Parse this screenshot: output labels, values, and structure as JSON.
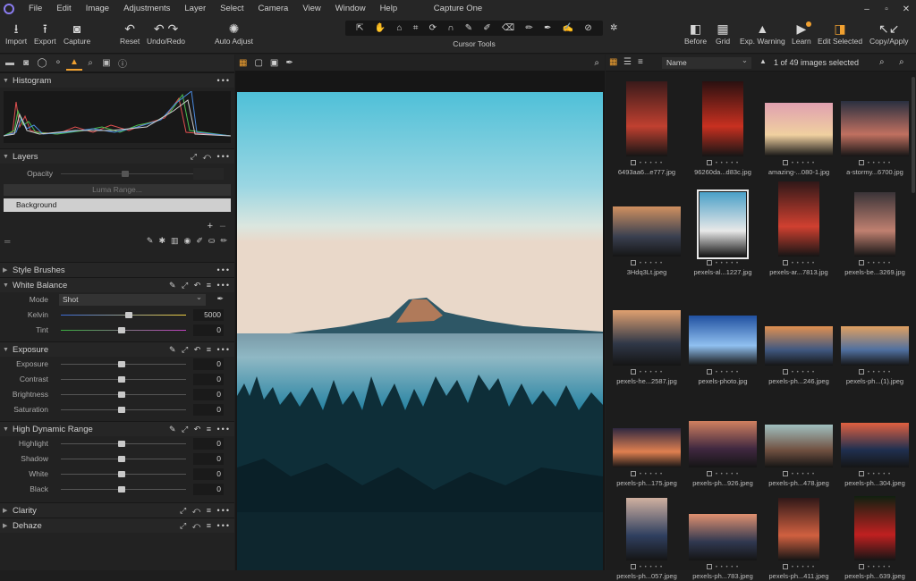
{
  "menubar": {
    "items": [
      "File",
      "Edit",
      "Image",
      "Adjustments",
      "Layer",
      "Select",
      "Camera",
      "View",
      "Window",
      "Help"
    ],
    "app_title": "Capture One"
  },
  "toolbar": {
    "left_buttons": [
      {
        "label": "Import",
        "icon": "import-icon"
      },
      {
        "label": "Export",
        "icon": "export-icon"
      },
      {
        "label": "Capture",
        "icon": "camera-icon"
      },
      {
        "label": "Reset",
        "icon": "reset-icon"
      },
      {
        "label": "Undo/Redo",
        "icon": "undo-redo-icon"
      },
      {
        "label": "Auto Adjust",
        "icon": "auto-adjust-icon"
      }
    ],
    "cursor_tools_label": "Cursor Tools",
    "right_buttons": [
      {
        "label": "Before",
        "icon": "before-after-icon"
      },
      {
        "label": "Grid",
        "icon": "grid-icon"
      },
      {
        "label": "Exp. Warning",
        "icon": "warning-icon"
      },
      {
        "label": "Learn",
        "icon": "learn-icon"
      },
      {
        "label": "Edit Selected",
        "icon": "edit-selected-icon"
      },
      {
        "label": "Copy/Apply",
        "icon": "copy-apply-icon"
      }
    ]
  },
  "tools": {
    "histogram": {
      "title": "Histogram"
    },
    "layers": {
      "title": "Layers",
      "opacity_label": "Opacity",
      "luma_range_label": "Luma Range...",
      "background_layer": "Background"
    },
    "style_brushes": {
      "title": "Style Brushes"
    },
    "white_balance": {
      "title": "White Balance",
      "mode_label": "Mode",
      "mode_value": "Shot",
      "kelvin_label": "Kelvin",
      "kelvin_value": "5000",
      "tint_label": "Tint",
      "tint_value": "0"
    },
    "exposure": {
      "title": "Exposure",
      "rows": [
        {
          "label": "Exposure",
          "value": "0"
        },
        {
          "label": "Contrast",
          "value": "0"
        },
        {
          "label": "Brightness",
          "value": "0"
        },
        {
          "label": "Saturation",
          "value": "0"
        }
      ]
    },
    "hdr": {
      "title": "High Dynamic Range",
      "rows": [
        {
          "label": "Highlight",
          "value": "0"
        },
        {
          "label": "Shadow",
          "value": "0"
        },
        {
          "label": "White",
          "value": "0"
        },
        {
          "label": "Black",
          "value": "0"
        }
      ]
    },
    "clarity": {
      "title": "Clarity"
    },
    "dehaze": {
      "title": "Dehaze"
    }
  },
  "browser": {
    "sort_value": "Name",
    "selection_count": "1 of 49 images selected",
    "thumbnails": [
      {
        "caption": "6493aa6...e777.jpg"
      },
      {
        "caption": "96260da...d83c.jpg"
      },
      {
        "caption": "amazing-...080-1.jpg"
      },
      {
        "caption": "a-stormy...6700.jpg"
      },
      {
        "caption": "3Hdq3Lt.jpeg"
      },
      {
        "caption": "pexels-al...1227.jpg"
      },
      {
        "caption": "pexels-ar...7813.jpg"
      },
      {
        "caption": "pexels-be...3269.jpg"
      },
      {
        "caption": "pexels-he...2587.jpg"
      },
      {
        "caption": "pexels-photo.jpg"
      },
      {
        "caption": "pexels-ph...246.jpeg"
      },
      {
        "caption": "pexels-ph...(1).jpeg"
      },
      {
        "caption": "pexels-ph...175.jpeg"
      },
      {
        "caption": "pexels-ph...926.jpeg"
      },
      {
        "caption": "pexels-ph...478.jpeg"
      },
      {
        "caption": "pexels-ph...304.jpeg"
      },
      {
        "caption": "pexels-ph...057.jpeg"
      },
      {
        "caption": "pexels-ph...783.jpeg"
      },
      {
        "caption": "pexels-ph...411.jpeg"
      },
      {
        "caption": "pexels-ph...639.jpeg"
      }
    ]
  },
  "colors": {
    "accent": "#f0a030",
    "panel": "#222222",
    "toolbar": "#262626"
  }
}
